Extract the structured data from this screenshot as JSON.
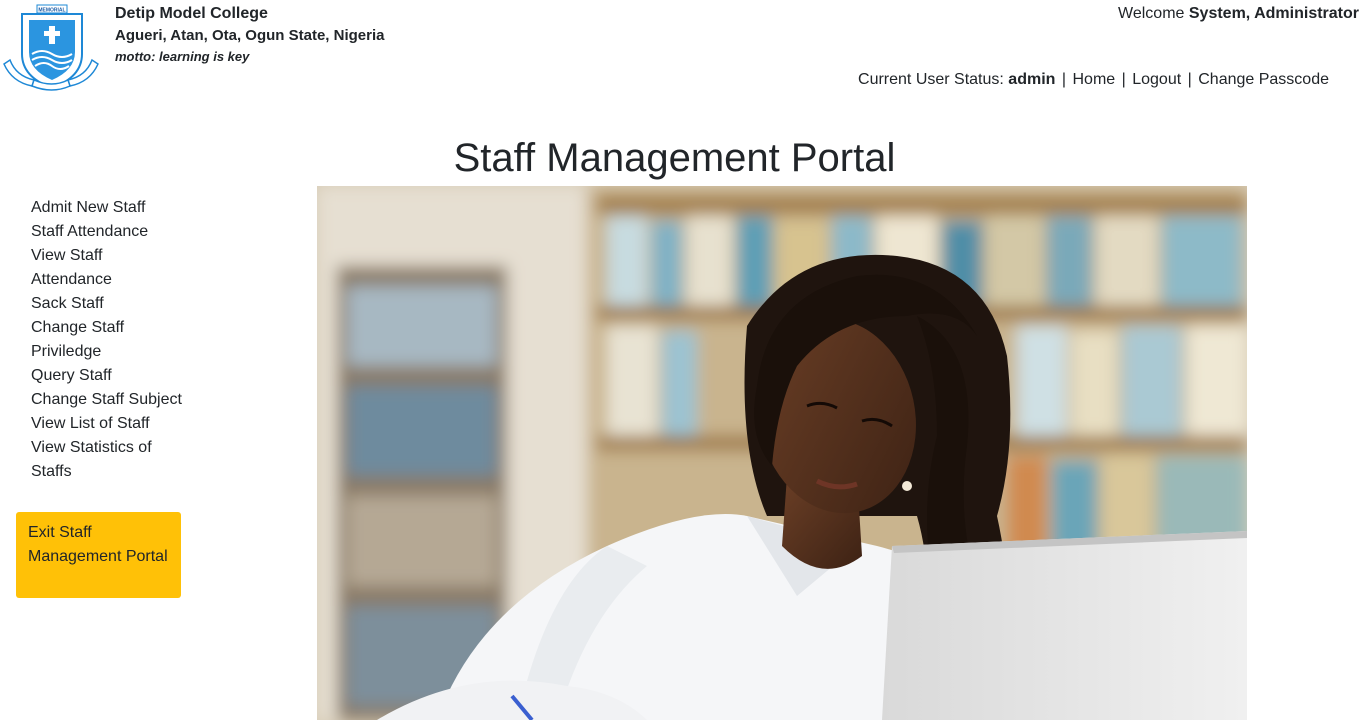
{
  "school": {
    "name": "Detip Model College",
    "address": "Agueri, Atan, Ota, Ogun State, Nigeria",
    "motto": "motto: learning is key",
    "logo_text": "MEMORIAL"
  },
  "header": {
    "welcome_prefix": "Welcome",
    "welcome_name": "System, Administrator",
    "status_prefix": "Current User Status:",
    "status_value": "admin",
    "links": {
      "home": "Home",
      "logout": "Logout",
      "change_passcode": "Change Passcode"
    },
    "separator": "|"
  },
  "page": {
    "title": "Staff Management Portal"
  },
  "sidebar": {
    "items": [
      {
        "label": "Admit New Staff"
      },
      {
        "label": "Staff Attendance"
      },
      {
        "label": "View Staff Attendance"
      },
      {
        "label": "Sack Staff"
      },
      {
        "label": "Change Staff Priviledge"
      },
      {
        "label": "Query Staff"
      },
      {
        "label": "Change Staff Subject"
      },
      {
        "label": "View List of Staff"
      },
      {
        "label": "View Statistics of Staffs"
      }
    ],
    "exit_label": "Exit Staff Management Portal"
  },
  "colors": {
    "exit_button": "#ffc107",
    "text": "#212529",
    "logo_blue": "#1e88d6"
  },
  "icons": {
    "logo": "school-crest-icon"
  }
}
